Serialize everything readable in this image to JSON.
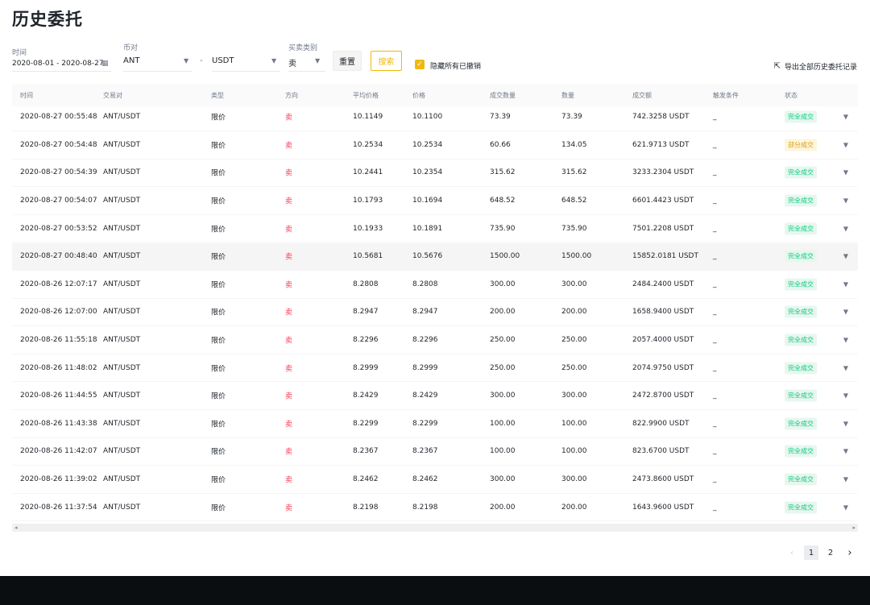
{
  "page": {
    "title": "历史委托"
  },
  "filters": {
    "time_label": "时间",
    "time_value": "2020-08-01 - 2020-08-27",
    "pair_label": "币对",
    "base_value": "ANT",
    "separator": "-",
    "quote_value": "USDT",
    "side_label": "买卖类别",
    "side_value": "卖",
    "reset_label": "重置",
    "search_label": "搜索",
    "hide_cancelled_label": "隐藏所有已撤销",
    "hide_cancelled_checked": true
  },
  "export_label": "导出全部历史委托记录",
  "table": {
    "headers": [
      "时间",
      "交易对",
      "类型",
      "方向",
      "平均价格",
      "价格",
      "成交数量",
      "数量",
      "成交额",
      "触发条件",
      "状态"
    ],
    "rows": [
      {
        "time": "2020-08-27 00:55:48",
        "pair": "ANT/USDT",
        "type": "限价",
        "side": "卖",
        "avg": "10.1149",
        "price": "10.1100",
        "filled": "73.39",
        "amount": "73.39",
        "total": "742.3258 USDT",
        "trigger": "_",
        "status": "完全成交",
        "status_kind": "done"
      },
      {
        "time": "2020-08-27 00:54:48",
        "pair": "ANT/USDT",
        "type": "限价",
        "side": "卖",
        "avg": "10.2534",
        "price": "10.2534",
        "filled": "60.66",
        "amount": "134.05",
        "total": "621.9713 USDT",
        "trigger": "_",
        "status": "部分成交",
        "status_kind": "partial"
      },
      {
        "time": "2020-08-27 00:54:39",
        "pair": "ANT/USDT",
        "type": "限价",
        "side": "卖",
        "avg": "10.2441",
        "price": "10.2354",
        "filled": "315.62",
        "amount": "315.62",
        "total": "3233.2304 USDT",
        "trigger": "_",
        "status": "完全成交",
        "status_kind": "done"
      },
      {
        "time": "2020-08-27 00:54:07",
        "pair": "ANT/USDT",
        "type": "限价",
        "side": "卖",
        "avg": "10.1793",
        "price": "10.1694",
        "filled": "648.52",
        "amount": "648.52",
        "total": "6601.4423 USDT",
        "trigger": "_",
        "status": "完全成交",
        "status_kind": "done"
      },
      {
        "time": "2020-08-27 00:53:52",
        "pair": "ANT/USDT",
        "type": "限价",
        "side": "卖",
        "avg": "10.1933",
        "price": "10.1891",
        "filled": "735.90",
        "amount": "735.90",
        "total": "7501.2208 USDT",
        "trigger": "_",
        "status": "完全成交",
        "status_kind": "done"
      },
      {
        "time": "2020-08-27 00:48:40",
        "pair": "ANT/USDT",
        "type": "限价",
        "side": "卖",
        "avg": "10.5681",
        "price": "10.5676",
        "filled": "1500.00",
        "amount": "1500.00",
        "total": "15852.0181 USDT",
        "trigger": "_",
        "status": "完全成交",
        "status_kind": "done",
        "highlight": true
      },
      {
        "time": "2020-08-26 12:07:17",
        "pair": "ANT/USDT",
        "type": "限价",
        "side": "卖",
        "avg": "8.2808",
        "price": "8.2808",
        "filled": "300.00",
        "amount": "300.00",
        "total": "2484.2400 USDT",
        "trigger": "_",
        "status": "完全成交",
        "status_kind": "done"
      },
      {
        "time": "2020-08-26 12:07:00",
        "pair": "ANT/USDT",
        "type": "限价",
        "side": "卖",
        "avg": "8.2947",
        "price": "8.2947",
        "filled": "200.00",
        "amount": "200.00",
        "total": "1658.9400 USDT",
        "trigger": "_",
        "status": "完全成交",
        "status_kind": "done"
      },
      {
        "time": "2020-08-26 11:55:18",
        "pair": "ANT/USDT",
        "type": "限价",
        "side": "卖",
        "avg": "8.2296",
        "price": "8.2296",
        "filled": "250.00",
        "amount": "250.00",
        "total": "2057.4000 USDT",
        "trigger": "_",
        "status": "完全成交",
        "status_kind": "done"
      },
      {
        "time": "2020-08-26 11:48:02",
        "pair": "ANT/USDT",
        "type": "限价",
        "side": "卖",
        "avg": "8.2999",
        "price": "8.2999",
        "filled": "250.00",
        "amount": "250.00",
        "total": "2074.9750 USDT",
        "trigger": "_",
        "status": "完全成交",
        "status_kind": "done"
      },
      {
        "time": "2020-08-26 11:44:55",
        "pair": "ANT/USDT",
        "type": "限价",
        "side": "卖",
        "avg": "8.2429",
        "price": "8.2429",
        "filled": "300.00",
        "amount": "300.00",
        "total": "2472.8700 USDT",
        "trigger": "_",
        "status": "完全成交",
        "status_kind": "done"
      },
      {
        "time": "2020-08-26 11:43:38",
        "pair": "ANT/USDT",
        "type": "限价",
        "side": "卖",
        "avg": "8.2299",
        "price": "8.2299",
        "filled": "100.00",
        "amount": "100.00",
        "total": "822.9900 USDT",
        "trigger": "_",
        "status": "完全成交",
        "status_kind": "done"
      },
      {
        "time": "2020-08-26 11:42:07",
        "pair": "ANT/USDT",
        "type": "限价",
        "side": "卖",
        "avg": "8.2367",
        "price": "8.2367",
        "filled": "100.00",
        "amount": "100.00",
        "total": "823.6700 USDT",
        "trigger": "_",
        "status": "完全成交",
        "status_kind": "done"
      },
      {
        "time": "2020-08-26 11:39:02",
        "pair": "ANT/USDT",
        "type": "限价",
        "side": "卖",
        "avg": "8.2462",
        "price": "8.2462",
        "filled": "300.00",
        "amount": "300.00",
        "total": "2473.8600 USDT",
        "trigger": "_",
        "status": "完全成交",
        "status_kind": "done"
      },
      {
        "time": "2020-08-26 11:37:54",
        "pair": "ANT/USDT",
        "type": "限价",
        "side": "卖",
        "avg": "8.2198",
        "price": "8.2198",
        "filled": "200.00",
        "amount": "200.00",
        "total": "1643.9600 USDT",
        "trigger": "_",
        "status": "完全成交",
        "status_kind": "done"
      }
    ]
  },
  "pagination": {
    "pages": [
      "1",
      "2"
    ],
    "current": "1"
  },
  "icons": {
    "calendar": "calendar-icon",
    "export": "external-link-icon",
    "dropdown": "caret-down-icon",
    "prev": "chevron-left-icon",
    "next": "chevron-right-icon"
  },
  "colors": {
    "accent": "#f0b90b",
    "sell": "#f6465d",
    "done_text": "#0ecb81",
    "partial_text": "#d9a21b"
  }
}
